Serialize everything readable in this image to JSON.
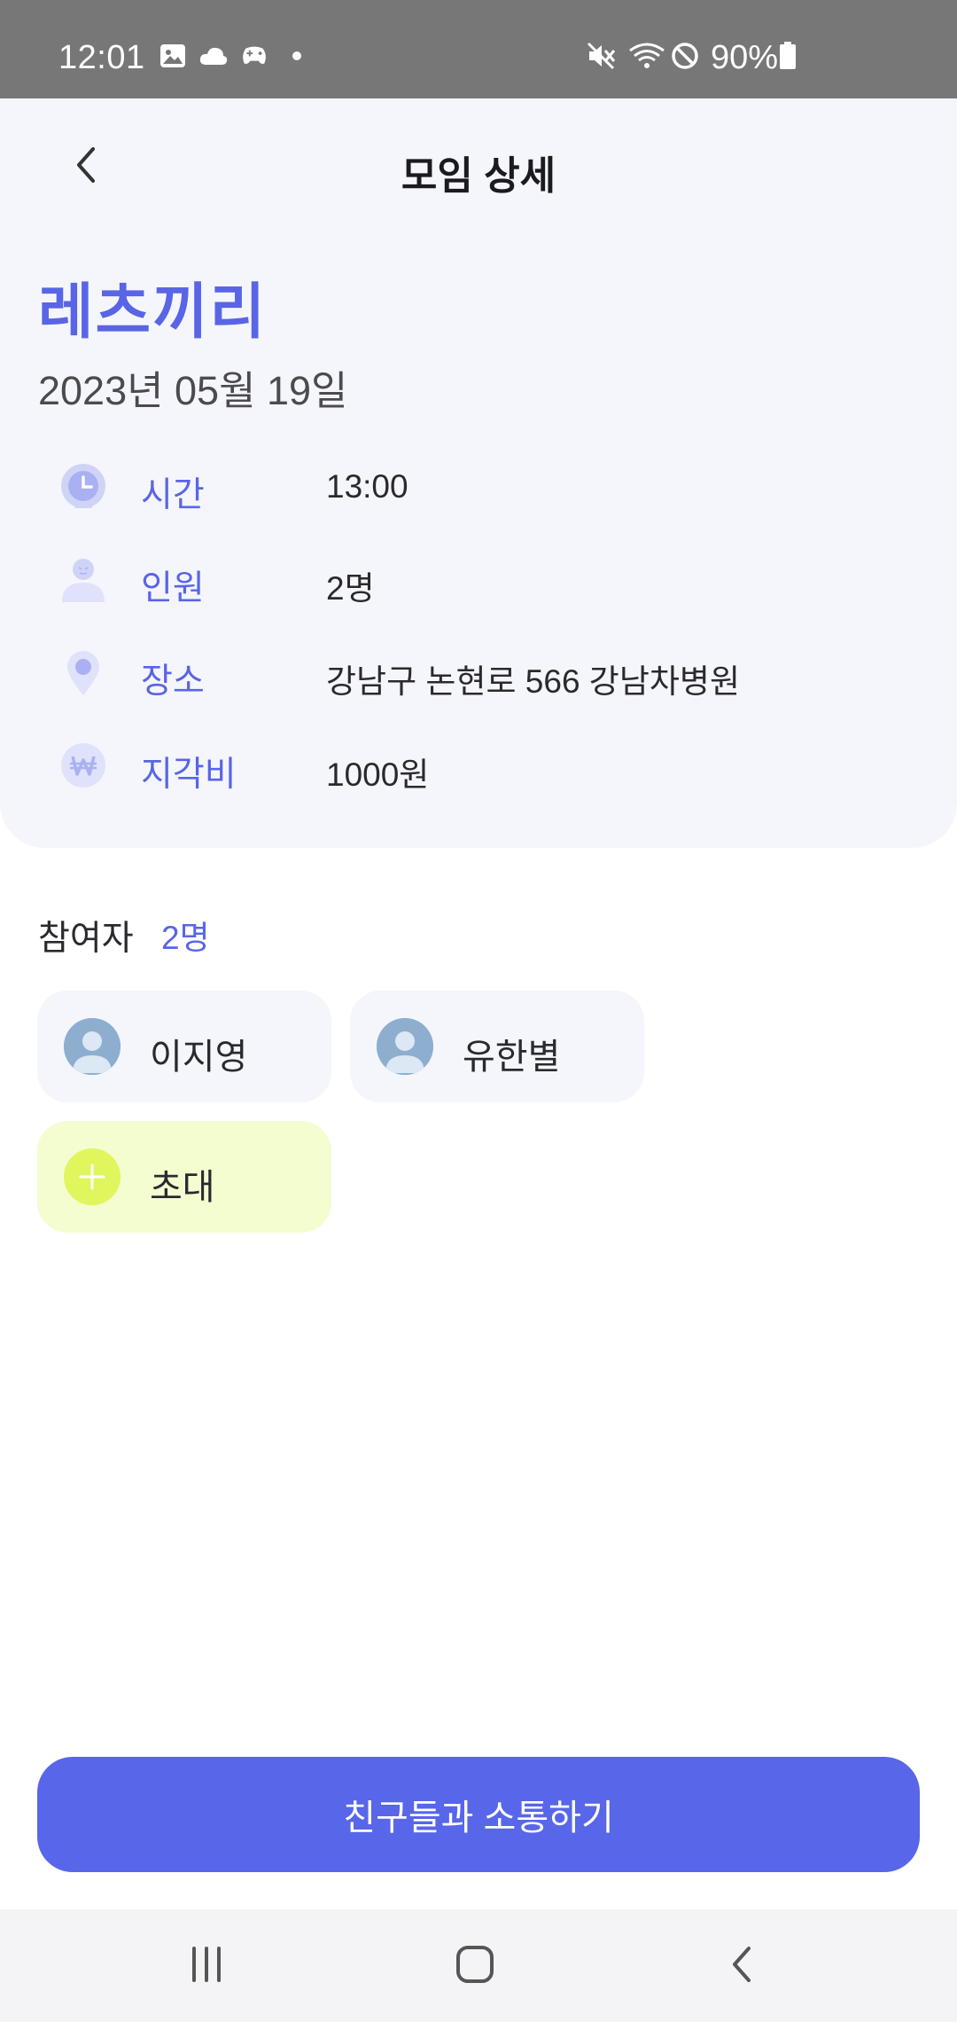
{
  "status_bar": {
    "time": "12:01",
    "battery": "90%",
    "left_icons": [
      "gallery-icon",
      "cloud-icon",
      "game-controller-icon",
      "dot-icon"
    ],
    "right_icons": [
      "mute-icon",
      "wifi-icon",
      "do-not-disturb-icon",
      "battery-icon"
    ]
  },
  "header": {
    "title": "모임 상세",
    "back_icon": "chevron-left-icon"
  },
  "meeting": {
    "name": "레츠끼리",
    "date": "2023년 05월 19일",
    "info": [
      {
        "icon": "clock-icon",
        "label": "시간",
        "value": "13:00"
      },
      {
        "icon": "person-icon",
        "label": "인원",
        "value": "2명"
      },
      {
        "icon": "location-pin-icon",
        "label": "장소",
        "value": "강남구 논현로 566 강남차병원"
      },
      {
        "icon": "won-coin-icon",
        "label": "지각비",
        "value": "1000원"
      }
    ]
  },
  "participants": {
    "label": "참여자",
    "count": "2명",
    "people": [
      {
        "name": "이지영"
      },
      {
        "name": "유한별"
      }
    ],
    "invite_label": "초대"
  },
  "cta": {
    "label": "친구들과 소통하기"
  },
  "colors": {
    "accent": "#5965e6",
    "button": "#5866ea",
    "invite_bg": "#f4fdd0",
    "invite_plus": "#e0f65c",
    "card_bg": "#f5f6fc"
  },
  "nav": {
    "recents_icon": "recents-icon",
    "home_icon": "home-icon",
    "back_icon": "back-icon"
  }
}
